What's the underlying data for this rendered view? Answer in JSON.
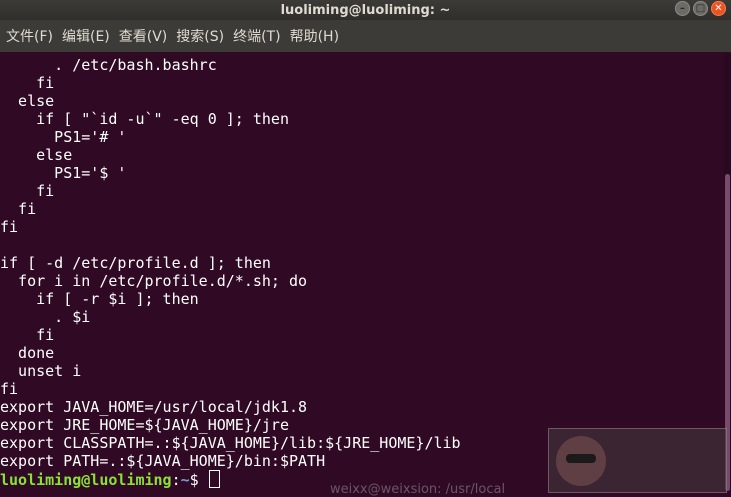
{
  "window": {
    "title": "luoliming@luoliming: ~"
  },
  "menubar": {
    "items": [
      "文件(F)",
      "编辑(E)",
      "查看(V)",
      "搜索(S)",
      "终端(T)",
      "帮助(H)"
    ]
  },
  "terminal": {
    "lines": [
      "      . /etc/bash.bashrc",
      "    fi",
      "  else",
      "    if [ \"`id -u`\" -eq 0 ]; then",
      "      PS1='# '",
      "    else",
      "      PS1='$ '",
      "    fi",
      "  fi",
      "fi",
      "",
      "if [ -d /etc/profile.d ]; then",
      "  for i in /etc/profile.d/*.sh; do",
      "    if [ -r $i ]; then",
      "      . $i",
      "    fi",
      "  done",
      "  unset i",
      "fi",
      "export JAVA_HOME=/usr/local/jdk1.8",
      "export JRE_HOME=${JAVA_HOME}/jre",
      "export CLASSPATH=.:${JAVA_HOME}/lib:${JRE_HOME}/lib",
      "export PATH=.:${JAVA_HOME}/bin:$PATH"
    ],
    "prompt": {
      "user_host": "luoliming@luoliming",
      "colon": ":",
      "path": "~",
      "symbol": "$ "
    }
  },
  "background": {
    "partial_text": "weixx@weixsion: /usr/local"
  }
}
